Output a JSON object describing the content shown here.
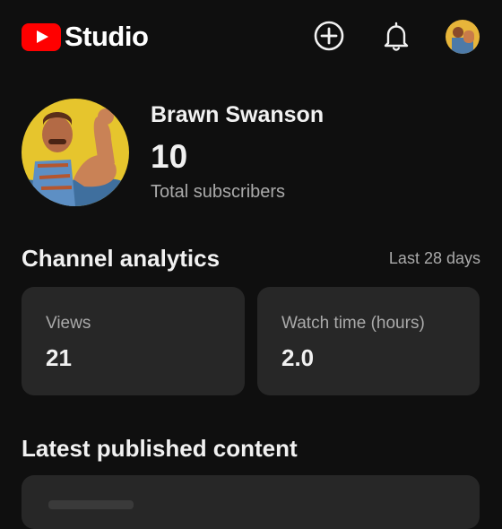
{
  "header": {
    "logo_text": "Studio",
    "create_icon": "plus-circle-icon",
    "notifications_icon": "bell-icon",
    "brand_color": "#ff0000"
  },
  "channel": {
    "name": "Brawn Swanson",
    "subscriber_count": "10",
    "subscriber_label": "Total subscribers"
  },
  "analytics": {
    "title": "Channel analytics",
    "range": "Last 28 days",
    "cards": [
      {
        "label": "Views",
        "value": "21"
      },
      {
        "label": "Watch time (hours)",
        "value": "2.0"
      }
    ]
  },
  "latest": {
    "title": "Latest published content"
  }
}
